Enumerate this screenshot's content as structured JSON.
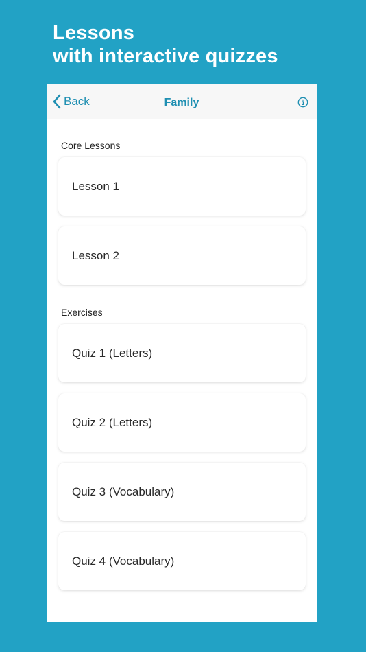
{
  "promo": {
    "line1": "Lessons",
    "line2": "with interactive quizzes"
  },
  "navbar": {
    "back_label": "Back",
    "title": "Family",
    "info_icon": "info-circle-icon",
    "accent_color": "#1f8fb2"
  },
  "sections": [
    {
      "label": "Core Lessons",
      "items": [
        "Lesson 1",
        "Lesson 2"
      ]
    },
    {
      "label": "Exercises",
      "items": [
        "Quiz 1 (Letters)",
        "Quiz 2 (Letters)",
        "Quiz 3 (Vocabulary)",
        "Quiz 4 (Vocabulary)"
      ]
    }
  ],
  "colors": {
    "background": "#22a2c5",
    "card": "#ffffff",
    "navbar": "#f7f7f7"
  }
}
